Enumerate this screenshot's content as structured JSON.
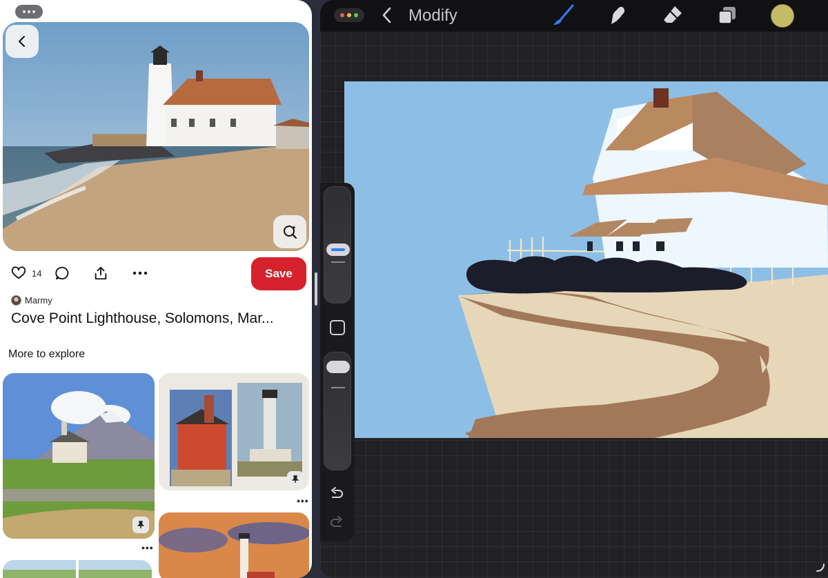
{
  "left_app": {
    "pin": {
      "like_count": "14",
      "save_label": "Save",
      "author": "Marmy",
      "title": "Cove Point Lighthouse, Solomons, Mar..."
    },
    "section_heading": "More to explore",
    "more_dots": "•••",
    "icons": [
      "chevron-left-icon",
      "visual-search-icon",
      "heart-icon",
      "comment-icon",
      "share-icon",
      "more-icon",
      "pin-icon"
    ]
  },
  "right_app": {
    "title": "Modify",
    "icons": [
      "brush-icon",
      "smudge-icon",
      "eraser-icon",
      "layers-icon",
      "undo-icon",
      "redo-icon"
    ],
    "colors": {
      "active_color": "#c4bc64",
      "brush_accent": "#2f7df6",
      "canvas_sky": "#8dbfe6"
    },
    "brush_size_level": 0.46,
    "opacity_level": 0.95
  }
}
